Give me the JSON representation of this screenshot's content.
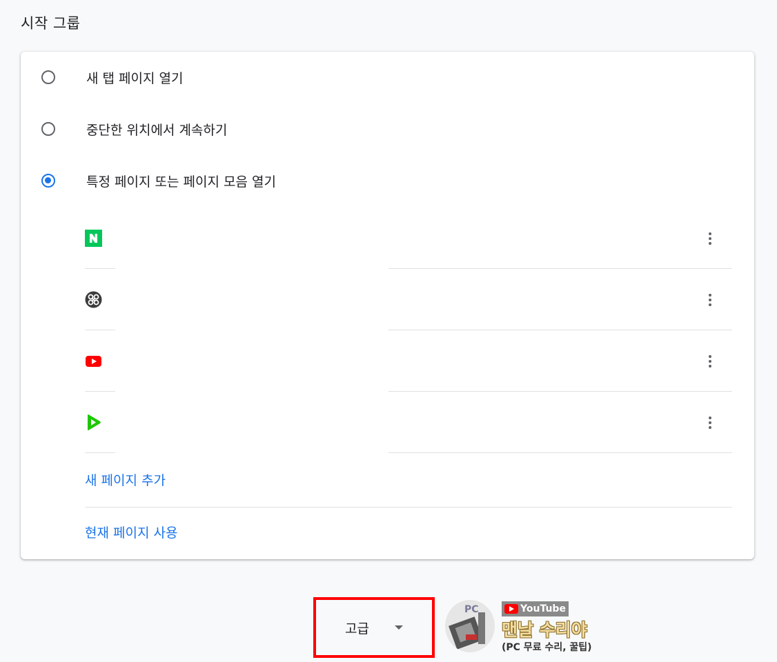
{
  "section": {
    "title": "시작 그룹"
  },
  "startup_options": [
    {
      "label": "새 탭 페이지 열기",
      "checked": false
    },
    {
      "label": "중단한 위치에서 계속하기",
      "checked": false
    },
    {
      "label": "특정 페이지 또는 페이지 모음 열기",
      "checked": true
    }
  ],
  "pages": [
    {
      "icon": "naver-icon",
      "color": "#03c75a"
    },
    {
      "icon": "app-link-icon",
      "color": "#3c3c3c"
    },
    {
      "icon": "youtube-icon",
      "color": "#ff0000"
    },
    {
      "icon": "play-icon",
      "color": "#1ec800"
    }
  ],
  "links": {
    "add_page": "새 페이지 추가",
    "use_current": "현재 페이지 사용"
  },
  "advanced": {
    "label": "고급"
  },
  "watermark": {
    "badge_text": "PC",
    "youtube_text": "YouTube",
    "title": "맨날 수리야",
    "subtitle": "(PC 무료 수리, 꿀팁)"
  },
  "colors": {
    "accent": "#1a73e8",
    "highlight_box": "#ff0000"
  }
}
